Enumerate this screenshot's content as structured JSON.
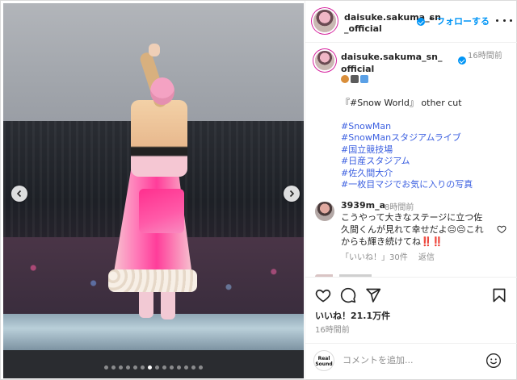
{
  "post_header": {
    "username": "daisuke.sakuma_sn_official",
    "separator": "•",
    "follow_label": "フォローする"
  },
  "caption": {
    "username": "daisuke.sakuma_sn_official",
    "time": "16時間前",
    "emojis": [
      "lion-face",
      "camera-flash",
      "up-arrow-button"
    ],
    "body_line1": "『#Snow World』 other cut",
    "hashtags": [
      "#SnowMan",
      "#SnowManスタジアムライブ",
      "#国立競技場",
      "#日産スタジアム",
      "#佐久間大介",
      "#一枚目マジでお気に入りの写真"
    ]
  },
  "comment": {
    "username": "3939m_a",
    "time": "8時間前",
    "text": "こうやって大きなステージに立つ佐久間くんが見れて幸せだよ😔😔これからも輝き続けてね‼️‼️",
    "likes": "「いいね！」30件",
    "reply_label": "返信"
  },
  "actions": {
    "likes_count": "いいね！21.1万件",
    "post_time": "16時間前"
  },
  "add_comment": {
    "placeholder": "コメントを追加...",
    "account_avatar_text": "Real Sound"
  },
  "carousel": {
    "total_slides": 14,
    "active_index": 6
  },
  "colors": {
    "accent": "#0095f6",
    "hashtag": "#3b5fe0",
    "muted": "#8e8e8e",
    "like_red": "#ed4956"
  }
}
